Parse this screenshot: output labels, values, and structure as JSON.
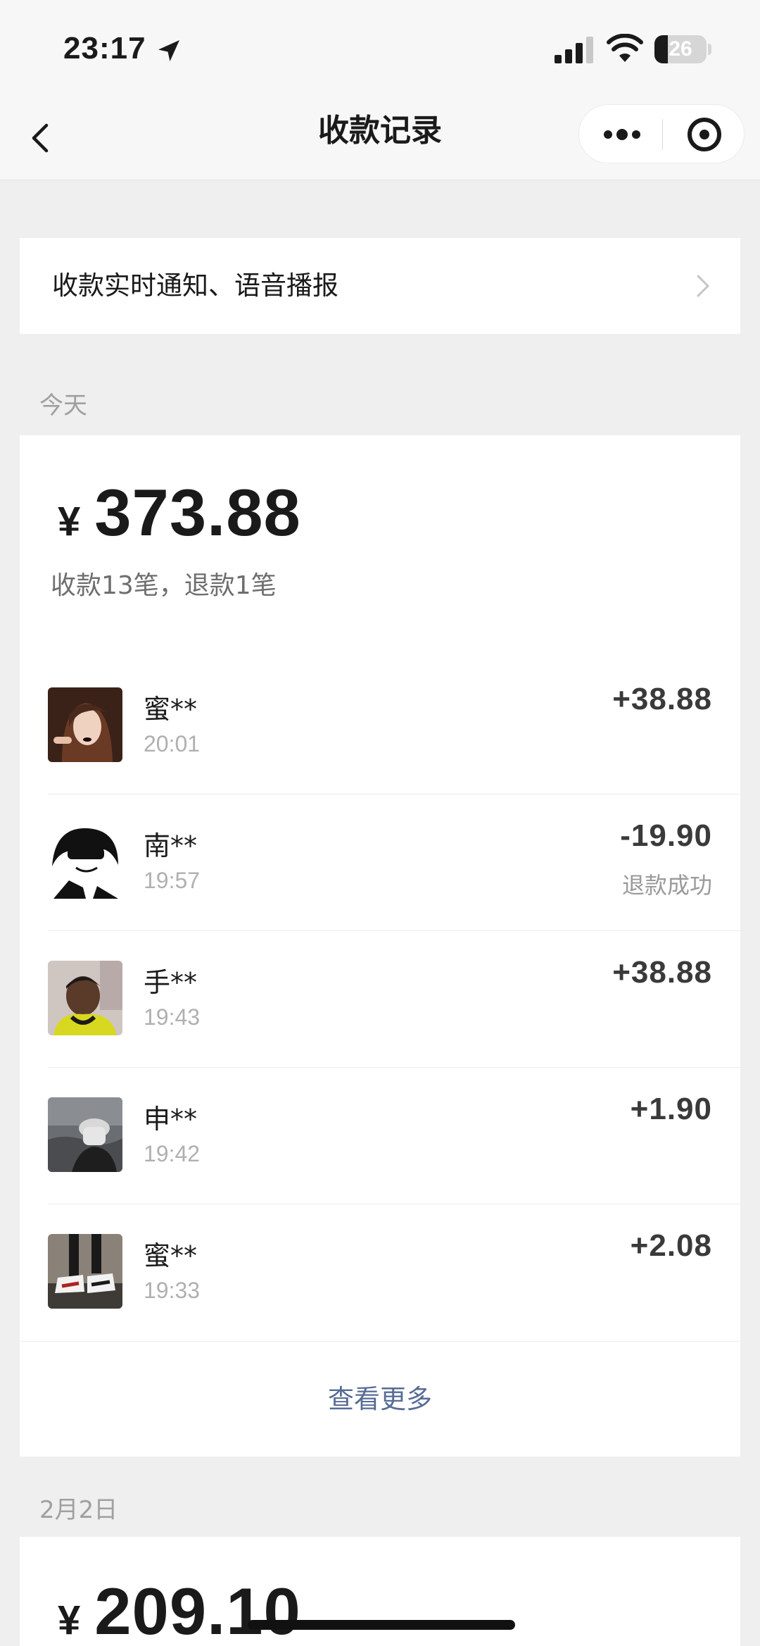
{
  "status_bar": {
    "time": "23:17",
    "battery": "26",
    "battery_level": 0.26,
    "icons": [
      "location-arrow-icon",
      "signal-icon",
      "wifi-icon",
      "battery-icon"
    ]
  },
  "nav": {
    "title": "收款记录",
    "icons": [
      "back-chevron-icon",
      "more-dots-icon",
      "target-icon"
    ]
  },
  "notify": {
    "label": "收款实时通知、语音播报",
    "icon": "chevron-right-icon"
  },
  "today": {
    "section_label": "今天",
    "currency": "¥",
    "total": "373.88",
    "summary": "收款13笔，退款1笔",
    "transactions": [
      {
        "name": "蜜**",
        "time": "20:01",
        "amount": "+38.88",
        "status": ""
      },
      {
        "name": "南**",
        "time": "19:57",
        "amount": "-19.90",
        "status": "退款成功"
      },
      {
        "name": "手**",
        "time": "19:43",
        "amount": "+38.88",
        "status": ""
      },
      {
        "name": "申**",
        "time": "19:42",
        "amount": "+1.90",
        "status": ""
      },
      {
        "name": "蜜**",
        "time": "19:33",
        "amount": "+2.08",
        "status": ""
      }
    ],
    "more_label": "查看更多"
  },
  "feb2": {
    "section_label": "2月2日",
    "currency": "¥",
    "total": "209.10"
  }
}
